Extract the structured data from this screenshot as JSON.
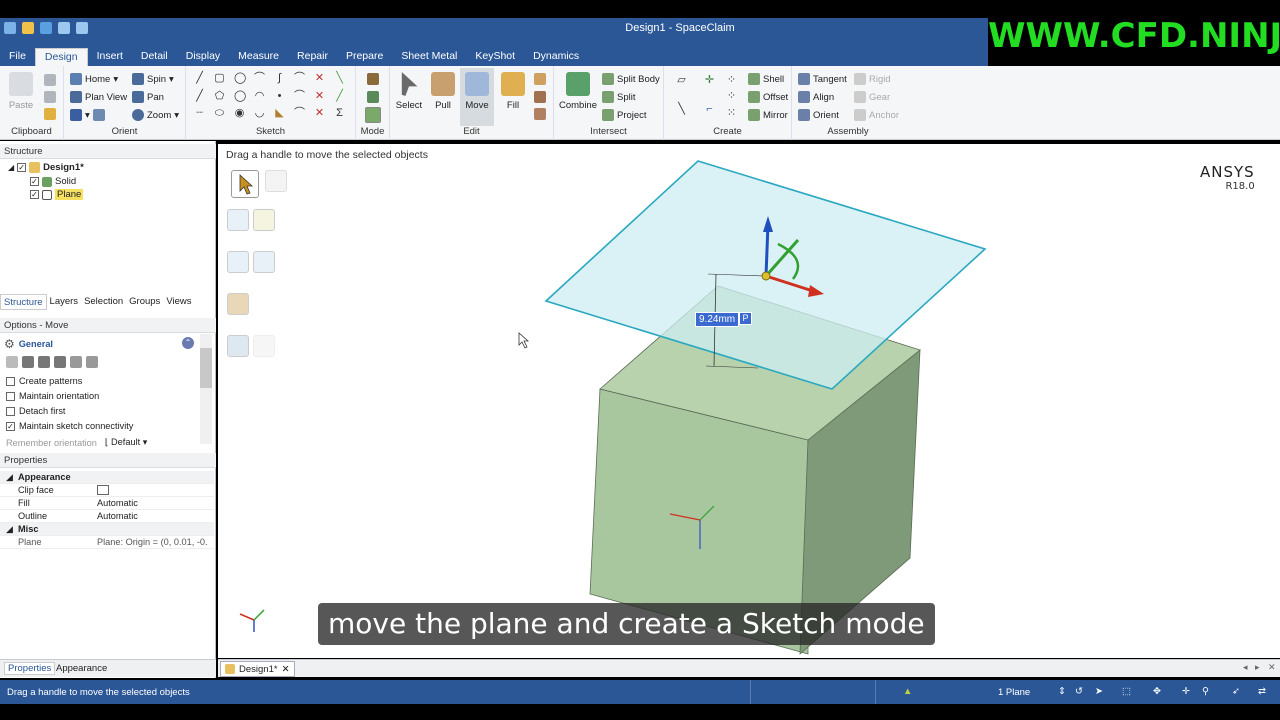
{
  "window": {
    "title": "Design1 - SpaceClaim",
    "watermark": "WWW.CFD.NINJA"
  },
  "tabs": [
    "File",
    "Design",
    "Insert",
    "Detail",
    "Display",
    "Measure",
    "Repair",
    "Prepare",
    "Sheet Metal",
    "KeyShot",
    "Dynamics"
  ],
  "ribbon": {
    "clipboard": {
      "paste": "Paste",
      "label": "Clipboard"
    },
    "orient": {
      "home": "Home",
      "spin": "Spin",
      "plan_view": "Plan View",
      "pan": "Pan",
      "zoom": "Zoom",
      "label": "Orient"
    },
    "sketch": {
      "label": "Sketch"
    },
    "mode": {
      "label": "Mode"
    },
    "edit": {
      "select": "Select",
      "pull": "Pull",
      "move": "Move",
      "fill": "Fill",
      "label": "Edit"
    },
    "intersect": {
      "combine": "Combine",
      "split_body": "Split Body",
      "split": "Split",
      "project": "Project",
      "label": "Intersect"
    },
    "create": {
      "shell": "Shell",
      "offset": "Offset",
      "mirror": "Mirror",
      "label": "Create"
    },
    "assembly": {
      "tangent": "Tangent",
      "rigid": "Rigid",
      "align": "Align",
      "gear": "Gear",
      "orient": "Orient",
      "anchor": "Anchor",
      "label": "Assembly"
    }
  },
  "structure": {
    "header": "Structure",
    "items": [
      {
        "label": "Design1*"
      },
      {
        "label": "Solid"
      },
      {
        "label": "Plane"
      }
    ],
    "tabs": [
      "Structure",
      "Layers",
      "Selection",
      "Groups",
      "Views"
    ]
  },
  "options": {
    "header": "Options - Move",
    "section": "General",
    "checks": [
      {
        "label": "Create patterns",
        "checked": false
      },
      {
        "label": "Maintain orientation",
        "checked": false
      },
      {
        "label": "Detach first",
        "checked": false
      },
      {
        "label": "Maintain sketch connectivity",
        "checked": true
      }
    ],
    "remember_label": "Remember orientation",
    "remember_value": "Default"
  },
  "properties": {
    "header": "Properties",
    "appearance_section": "Appearance",
    "rows": [
      {
        "key": "Clip face",
        "value": ""
      },
      {
        "key": "Fill",
        "value": "Automatic"
      },
      {
        "key": "Outline",
        "value": "Automatic"
      }
    ],
    "misc_section": "Misc",
    "plane_key": "Plane",
    "plane_value": "Plane: Origin = (0, 0.01, -0.",
    "bottom_tabs": [
      "Properties",
      "Appearance"
    ]
  },
  "viewport": {
    "hint": "Drag a handle to move the selected objects",
    "brand": "ANSYS",
    "version": "R18.0",
    "dimension": "9.24mm",
    "subtitle": "move the plane and create a Sketch mode",
    "doc_tab": "Design1*"
  },
  "status": {
    "message": "Drag a handle to move the selected objects",
    "selection": "1 Plane"
  },
  "colors": {
    "accent": "#2b5797",
    "watermark": "#22dd22",
    "plane": "#d6f0f4",
    "solid": "#a9c79f"
  }
}
